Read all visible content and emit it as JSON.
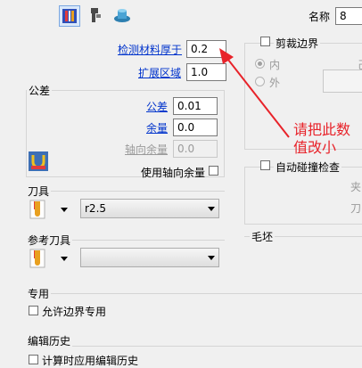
{
  "toolbar": {
    "icons": [
      "toolpath-strategy-icon",
      "holder-icon",
      "stock-model-icon"
    ],
    "name_label": "名称",
    "name_value": "8"
  },
  "thickness": {
    "label": "检测材料厚于",
    "value": "0.2"
  },
  "expand": {
    "label": "扩展区域",
    "value": "1.0"
  },
  "tolerance_group": {
    "title": "公差",
    "tolerance_label": "公差",
    "tolerance_value": "0.01",
    "allowance_label": "余量",
    "allowance_value": "0.0",
    "axial_label": "轴向余量",
    "axial_value": "0.0",
    "use_axial_label": "使用轴向余量"
  },
  "trim_group": {
    "title": "剪裁边界",
    "inside": "内",
    "outside": "外",
    "right_cut": "己"
  },
  "annotation": {
    "line1": "请把此数",
    "line2": "值改小",
    "color": "#e8232a"
  },
  "collision_group": {
    "title": "自动碰撞检查",
    "right_text_1": "夹",
    "right_text_2": "刀"
  },
  "tool_group": {
    "title": "刀具",
    "selected_tool": "r2.5"
  },
  "ref_tool_group": {
    "title": "参考刀具",
    "selected_tool": ""
  },
  "stock_group": {
    "title": "毛坯"
  },
  "special_group": {
    "title": "专用",
    "allow_boundary_label": "允许边界专用"
  },
  "history_group": {
    "title": "编辑历史",
    "partial_text": "计算时应用编辑历史"
  }
}
